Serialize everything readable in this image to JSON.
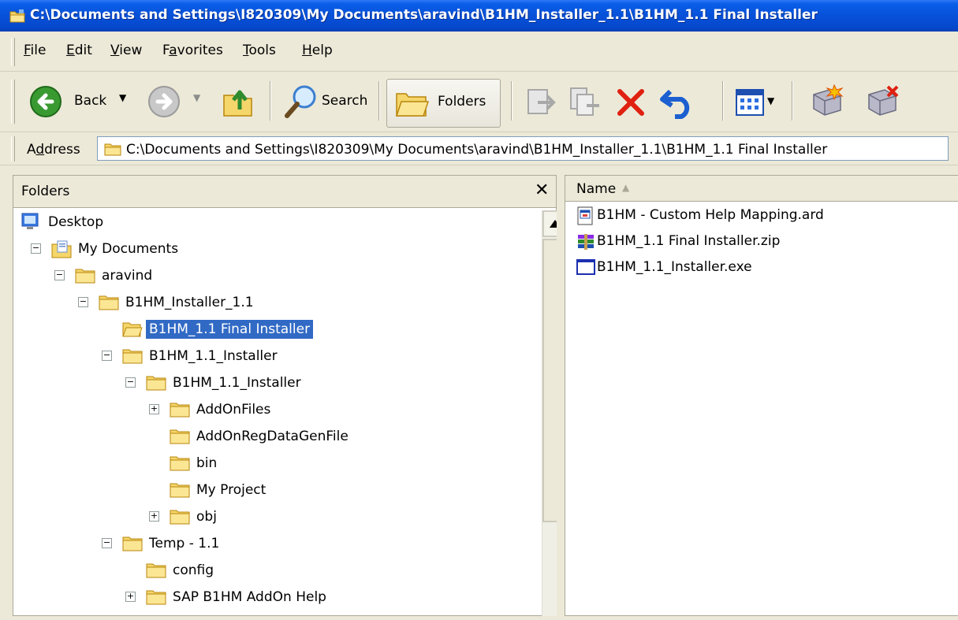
{
  "window": {
    "title": "C:\\Documents and Settings\\I820309\\My Documents\\aravind\\B1HM_Installer_1.1\\B1HM_1.1 Final Installer"
  },
  "menu": {
    "items": [
      {
        "label": "File",
        "accel": "F",
        "rest": "ile"
      },
      {
        "label": "Edit",
        "accel": "E",
        "rest": "dit"
      },
      {
        "label": "View",
        "accel": "V",
        "rest": "iew"
      },
      {
        "label": "Favorites",
        "pre": "F",
        "accel": "a",
        "rest": "vorites"
      },
      {
        "label": "Tools",
        "accel": "T",
        "rest": "ools"
      },
      {
        "label": "Help",
        "accel": "H",
        "rest": "elp"
      }
    ]
  },
  "toolbar": {
    "back_label": "Back",
    "search_label": "Search",
    "folders_label": "Folders"
  },
  "address": {
    "label": "Address",
    "value": "C:\\Documents and Settings\\I820309\\My Documents\\aravind\\B1HM_Installer_1.1\\B1HM_1.1 Final Installer"
  },
  "folders_pane": {
    "title": "Folders",
    "close_glyph": "✕",
    "tree": [
      {
        "label": "Desktop",
        "level": 0,
        "expander": "none",
        "icon": "desktop-icon"
      },
      {
        "label": "My Documents",
        "level": 1,
        "expander": "minus",
        "icon": "my-documents-icon"
      },
      {
        "label": "aravind",
        "level": 2,
        "expander": "minus",
        "icon": "folder-icon"
      },
      {
        "label": "B1HM_Installer_1.1",
        "level": 3,
        "expander": "minus",
        "icon": "folder-icon"
      },
      {
        "label": "B1HM_1.1 Final Installer",
        "level": 4,
        "expander": "none",
        "icon": "folder-open-icon",
        "selected": true
      },
      {
        "label": "B1HM_1.1_Installer",
        "level": 4,
        "expander": "minus",
        "icon": "folder-icon"
      },
      {
        "label": "B1HM_1.1_Installer",
        "level": 5,
        "expander": "minus",
        "icon": "folder-icon"
      },
      {
        "label": "AddOnFiles",
        "level": 6,
        "expander": "plus",
        "icon": "folder-icon"
      },
      {
        "label": "AddOnRegDataGenFile",
        "level": 6,
        "expander": "none",
        "icon": "folder-icon"
      },
      {
        "label": "bin",
        "level": 6,
        "expander": "none",
        "icon": "folder-icon"
      },
      {
        "label": "My Project",
        "level": 6,
        "expander": "none",
        "icon": "folder-icon"
      },
      {
        "label": "obj",
        "level": 6,
        "expander": "plus",
        "icon": "folder-icon"
      },
      {
        "label": "Temp - 1.1",
        "level": 4,
        "expander": "minus",
        "icon": "folder-icon"
      },
      {
        "label": "config",
        "level": 5,
        "expander": "none",
        "icon": "folder-icon"
      },
      {
        "label": "SAP B1HM AddOn Help",
        "level": 5,
        "expander": "plus",
        "icon": "folder-icon"
      }
    ]
  },
  "files_pane": {
    "column_name": "Name",
    "files": [
      {
        "label": "B1HM - Custom Help Mapping.ard",
        "icon": "ard-file-icon"
      },
      {
        "label": "B1HM_1.1 Final Installer.zip",
        "icon": "winrar-archive-icon"
      },
      {
        "label": "B1HM_1.1_Installer.exe",
        "icon": "exe-file-icon"
      }
    ]
  },
  "colors": {
    "titlebar": "#0751D9",
    "selection": "#316AC5",
    "chrome": "#ECE9D8",
    "folder": "#F5D66B"
  }
}
